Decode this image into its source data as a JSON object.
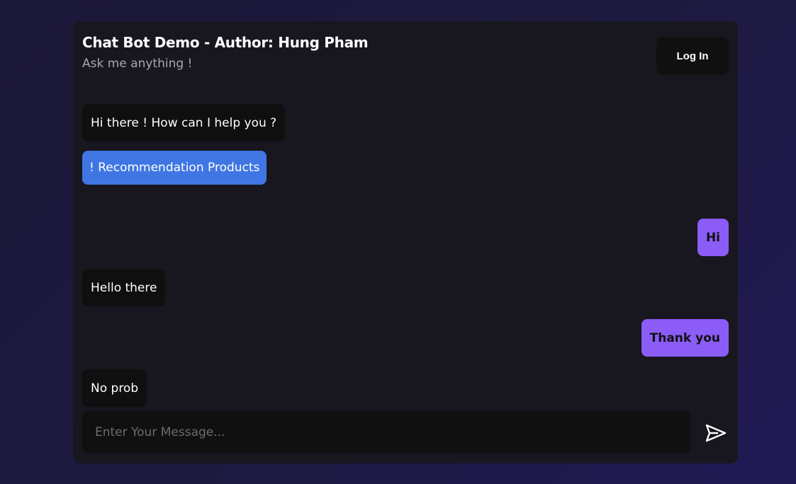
{
  "header": {
    "title": "Chat Bot Demo - Author: Hung Pham",
    "subtitle": "Ask me anything !",
    "login_label": "Log In"
  },
  "messages": [
    {
      "sender": "bot",
      "text": "Hi there ! How can I help you ?"
    },
    {
      "sender": "action",
      "text": "! Recommendation Products"
    },
    {
      "sender": "user",
      "text": "Hi"
    },
    {
      "sender": "bot",
      "text": "Hello there"
    },
    {
      "sender": "user",
      "text": "Thank you"
    },
    {
      "sender": "bot",
      "text": "No prob"
    }
  ],
  "composer": {
    "placeholder": "Enter Your Message...",
    "value": "",
    "send_icon": "send-icon"
  },
  "colors": {
    "user_bubble": "#8b5cf6",
    "bot_bubble": "#0f0f10",
    "action_button": "#3f76e3",
    "panel": "#18161f"
  }
}
